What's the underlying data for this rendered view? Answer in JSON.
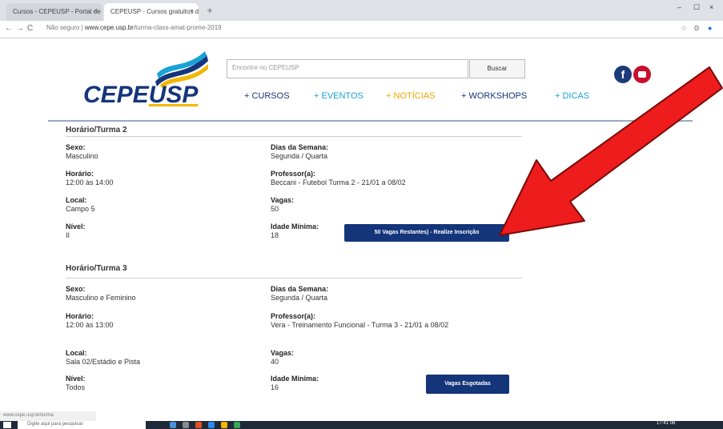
{
  "browser": {
    "tab1_title": "Cursos - CEPEUSP - Portal de ...",
    "tab2_title": "CEPEUSP - Cursos gratuitos d...",
    "tab_close": "×",
    "new_tab": "+",
    "back": "←",
    "forward": "→",
    "reload": "C",
    "security_label": "Não seguro",
    "url_domain": "www.cepe.usp.br",
    "url_path": "/turma-class-amat-prome-2019",
    "minimize": "–",
    "maximize": "☐",
    "close": "×"
  },
  "site": {
    "logo_main": "CEPE",
    "logo_accent": "USP",
    "search_placeholder": "Encontre no CEPEUSP",
    "search_button": "Buscar",
    "facebook_glyph": "f",
    "menu": {
      "cursos": "+ CURSOS",
      "eventos": "+ EVENTOS",
      "noticias": "+ NOTÍCIAS",
      "workshops": "+ WORKSHOPS",
      "dicas": "+ DICAS"
    }
  },
  "turma2": {
    "title": "Horário/Turma 2",
    "sexo_label": "Sexo:",
    "sexo_value": "Masculino",
    "dias_label": "Dias da Semana:",
    "dias_value": "Segunda / Quarta",
    "horario_label": "Horário:",
    "horario_value": "12:00 às 14:00",
    "professor_label": "Professor(a):",
    "professor_value": "Beccani - Futebol Turma 2 - 21/01 a 08/02",
    "local_label": "Local:",
    "local_value": "Campo 5",
    "vagas_label": "Vagas:",
    "vagas_value": "50",
    "nivel_label": "Nível:",
    "nivel_value": "II",
    "idade_label": "Idade Mínima:",
    "idade_value": "18",
    "button": "50 Vagas Restantes) - Realize Inscrição"
  },
  "turma3": {
    "title": "Horário/Turma 3",
    "sexo_label": "Sexo:",
    "sexo_value": "Masculino e Feminino",
    "dias_label": "Dias da Semana:",
    "dias_value": "Segunda / Quarta",
    "horario_label": "Horário:",
    "horario_value": "12:00 às 13:00",
    "professor_label": "Professor(a):",
    "professor_value": "Vera - Treinamento Funcional - Turma 3 - 21/01 a 08/02",
    "local_label": "Local:",
    "local_value": "Sala 02/Estádio e Pista",
    "vagas_label": "Vagas:",
    "vagas_value": "40",
    "nivel_label": "Nível:",
    "nivel_value": "Todos",
    "idade_label": "Idade Mínima:",
    "idade_value": "16",
    "button": "Vagas Esgotadas"
  },
  "status": {
    "statusbar_text": "www.cepe.usp.br/turma",
    "taskbar_search": "Digite aqui para pesquisar",
    "clock": "17:41 08"
  },
  "colors": {
    "brand_navy": "#14357a",
    "brand_cyan": "#1aa1d6",
    "brand_yellow": "#f0a500",
    "arrow_red": "#ee1c1c"
  }
}
